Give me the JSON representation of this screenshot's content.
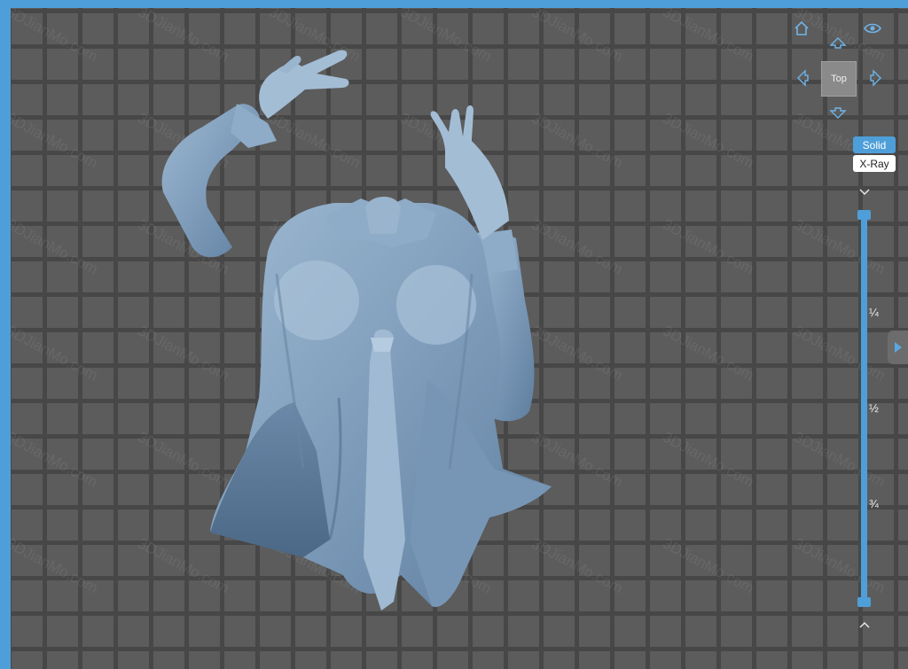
{
  "viewport": {
    "watermark": "3DJianMo.com"
  },
  "view_controls": {
    "home_icon": "home-icon",
    "visibility_icon": "eye-icon",
    "view_up_icon": "arrow-up-icon",
    "view_down_icon": "arrow-down-icon",
    "view_left_icon": "arrow-left-icon",
    "view_right_icon": "arrow-right-icon",
    "current_view": "Top"
  },
  "render_modes": {
    "solid": "Solid",
    "xray": "X-Ray",
    "active": "Solid",
    "accent_color": "#4e9fd9"
  },
  "section_slider": {
    "ticks": [
      "¼",
      "½",
      "¾"
    ],
    "collapse_icon": "chevron-down-icon",
    "expand_icon": "chevron-up-icon",
    "top_value": 0,
    "bottom_value": 1
  },
  "side_panel": {
    "toggle_icon": "triangle-right-icon"
  }
}
